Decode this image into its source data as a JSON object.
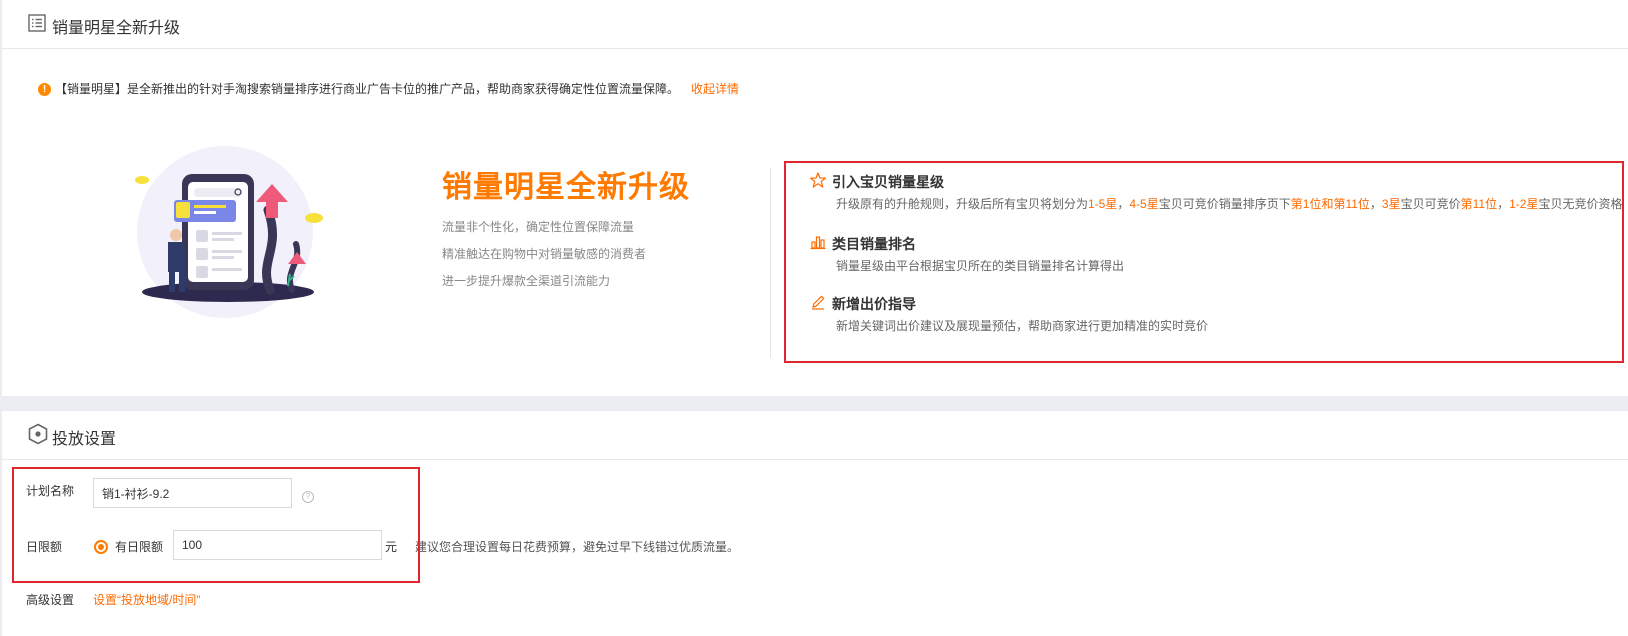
{
  "section_top": {
    "title": "销量明星全新升级",
    "notice": "【销量明星】是全新推出的针对手淘搜索销量排序进行商业广告卡位的推广产品，帮助商家获得确定性位置流量保障。",
    "notice_link": "收起详情",
    "promo_title": "销量明星全新升级",
    "promo_lines": [
      "流量非个性化，确定性位置保障流量",
      "精准触达在购物中对销量敏感的消费者",
      "进一步提升爆款全渠道引流能力"
    ],
    "features": [
      {
        "name": "引入宝贝销量星级",
        "icon": "star-icon",
        "desc_parts": [
          {
            "text": "升级原有的升舱规则，升级后所有宝贝将划分为",
            "hl": false
          },
          {
            "text": "1-5星",
            "hl": true
          },
          {
            "text": "，",
            "hl": false
          },
          {
            "text": "4-5星",
            "hl": true
          },
          {
            "text": "宝贝可竞价销量排序页下",
            "hl": false
          },
          {
            "text": "第1位和第11位",
            "hl": true
          },
          {
            "text": "，",
            "hl": false
          },
          {
            "text": "3星",
            "hl": true
          },
          {
            "text": "宝贝可竞价",
            "hl": false
          },
          {
            "text": "第11位",
            "hl": true
          },
          {
            "text": "，",
            "hl": false
          },
          {
            "text": "1-2星",
            "hl": true
          },
          {
            "text": "宝贝无竞价资格",
            "hl": false
          }
        ]
      },
      {
        "name": "类目销量排名",
        "icon": "bar-chart-icon",
        "desc": "销量星级由平台根据宝贝所在的类目销量排名计算得出"
      },
      {
        "name": "新增出价指导",
        "icon": "pencil-icon",
        "desc": "新增关键词出价建议及展现量预估，帮助商家进行更加精准的实时竞价"
      }
    ]
  },
  "section_bottom": {
    "title": "投放设置",
    "plan_name_label": "计划名称",
    "plan_name_value": "销1-衬衫-9.2",
    "help_glyph": "?",
    "daily_limit_label": "日限额",
    "daily_limit_radio_label": "有日限额",
    "daily_limit_value": "100",
    "daily_limit_unit": "元",
    "daily_limit_hint": "建议您合理设置每日花费预算，避免过早下线错过优质流量。",
    "advanced_label": "高级设置",
    "advanced_link": "设置“投放地域/时间”"
  },
  "colors": {
    "accent": "#ff7a00",
    "link": "#ff6a00",
    "highlight_box": "#e0262d",
    "background": "#ebedf3"
  }
}
